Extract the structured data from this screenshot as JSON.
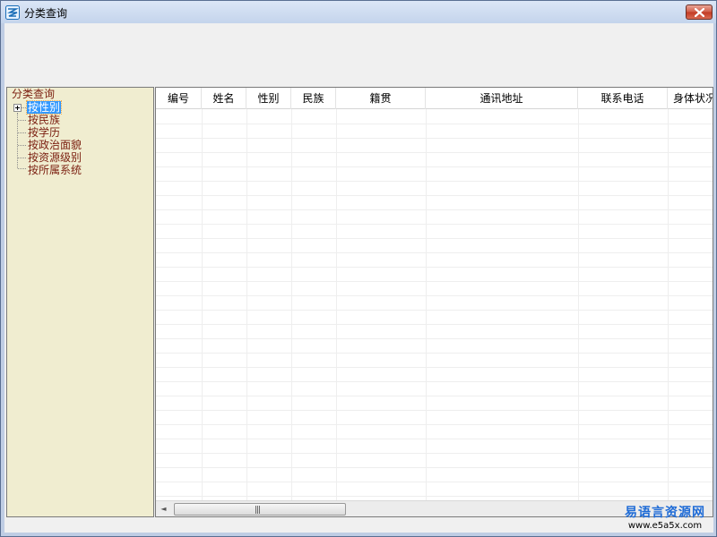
{
  "window": {
    "title": "分类查询",
    "close_label": "×"
  },
  "tree": {
    "root_label": "分类查询",
    "items": [
      {
        "label": "按性别",
        "selected": true
      },
      {
        "label": "按民族",
        "selected": false
      },
      {
        "label": "按学历",
        "selected": false
      },
      {
        "label": "按政治面貌",
        "selected": false
      },
      {
        "label": "按资源级别",
        "selected": false
      },
      {
        "label": "按所属系统",
        "selected": false
      }
    ]
  },
  "grid": {
    "columns": [
      "编号",
      "姓名",
      "性别",
      "民族",
      "籍贯",
      "通讯地址",
      "联系电话",
      "身体状况"
    ],
    "rows": []
  },
  "scrollbar": {
    "left_arrow": "◄",
    "grip": "|||"
  },
  "watermark": {
    "brand": "易语言资源网",
    "url": "www.e5a5x.com"
  },
  "colors": {
    "tree_background": "#f0edd0",
    "tree_text": "#7b1f10",
    "selection": "#3399ff",
    "watermark_brand": "#1e6bd6"
  }
}
